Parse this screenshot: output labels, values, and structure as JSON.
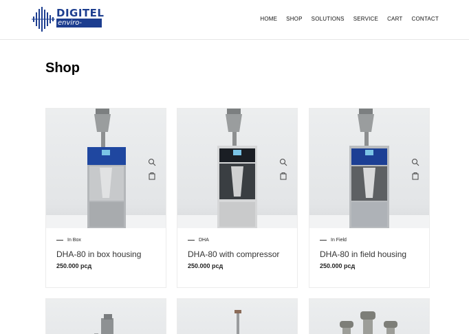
{
  "header": {
    "logo_text": "DIGITEL",
    "logo_sub": "enviro-sense",
    "nav": [
      "HOME",
      "SHOP",
      "SOLUTIONS",
      "SERVICE",
      "CART",
      "CONTACT"
    ]
  },
  "page": {
    "title": "Shop"
  },
  "products": [
    {
      "category": "In Box",
      "name": "DHA-80 in box housing",
      "price": "250.000 рсд"
    },
    {
      "category": "DHA",
      "name": "DHA-80 with compressor",
      "price": "250.000 рсд"
    },
    {
      "category": "In Field",
      "name": "DHA-80 in field housing",
      "price": "250.000 рсд"
    }
  ],
  "icons": {
    "zoom": "magnifier-icon",
    "cart": "bag-icon"
  },
  "colors": {
    "brand": "#1c3d8f"
  }
}
